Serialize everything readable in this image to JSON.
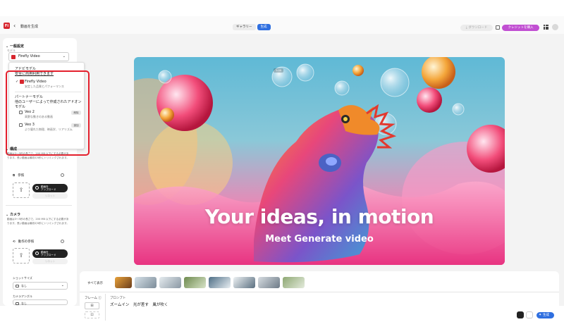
{
  "header": {
    "logo": "Fi",
    "back_glyph": "‹",
    "title": "動画を生成",
    "tabs": [
      {
        "label": "ギャラリー",
        "active": false
      },
      {
        "label": "生成",
        "active": true
      }
    ],
    "download_label": "⤓ ダウンロード",
    "buy_credits_label": "クレジットを購入",
    "accent": "#2f6fe0",
    "buy_color": "#c14fd2"
  },
  "sidebar": {
    "general_title": "一般設定",
    "model_sublabel": "モデル",
    "model_selected": "Firefly Video",
    "dropdown": {
      "adobe_title": "アドビモデル",
      "adobe_subtitle": "安全に商用利用できます",
      "firefly_name": "Firefly Video",
      "firefly_desc": "安定した品質とパフォーマンス",
      "partner_title": "パートナーモデル",
      "partner_subtitle": "他のユーザーによって作成されたアドオンモデル",
      "veo2_name": "Veo 2",
      "veo2_desc": "高野な動きのある動画",
      "veo2_badge": "削除",
      "veo3_name": "Veo 3",
      "veo3_desc": "より優れた物理、映画学、リアリズム",
      "veo3_badge": "追加"
    },
    "composition_title": "構成",
    "composition_desc": "動画は3〜5秒の長さで、200 MB 以下にする必要があります。長い動画は最初の5秒にトリミングされます。",
    "reference_label": "参照",
    "upload_label": "動画を\nアップロード",
    "gray_label": "リネット",
    "camera_title": "カメラ",
    "camera_desc": "動画は3〜5秒の長さで、200 MB 以下にする必要があります。長い動画は最初の5秒にトリミングされます。",
    "motion_ref_label": "動作の参照",
    "upload_label2": "動画を\nアップロード",
    "gray_label2": "リネット",
    "shot_size_label": "ショットサイズ",
    "shot_size_value": "なし",
    "camera_angle_label": "カメラアングル",
    "camera_angle_value": "なし"
  },
  "hero": {
    "timer": "1:00",
    "title": "Your ideas, in motion",
    "subtitle": "Meet Generate video"
  },
  "bottom": {
    "all_label": "すべて表示",
    "frame_label": "フレーム",
    "prompt_label": "プロンプト",
    "prompt_text": "ズームイン　光が差す　風が吹く",
    "generate_label": "生成"
  }
}
